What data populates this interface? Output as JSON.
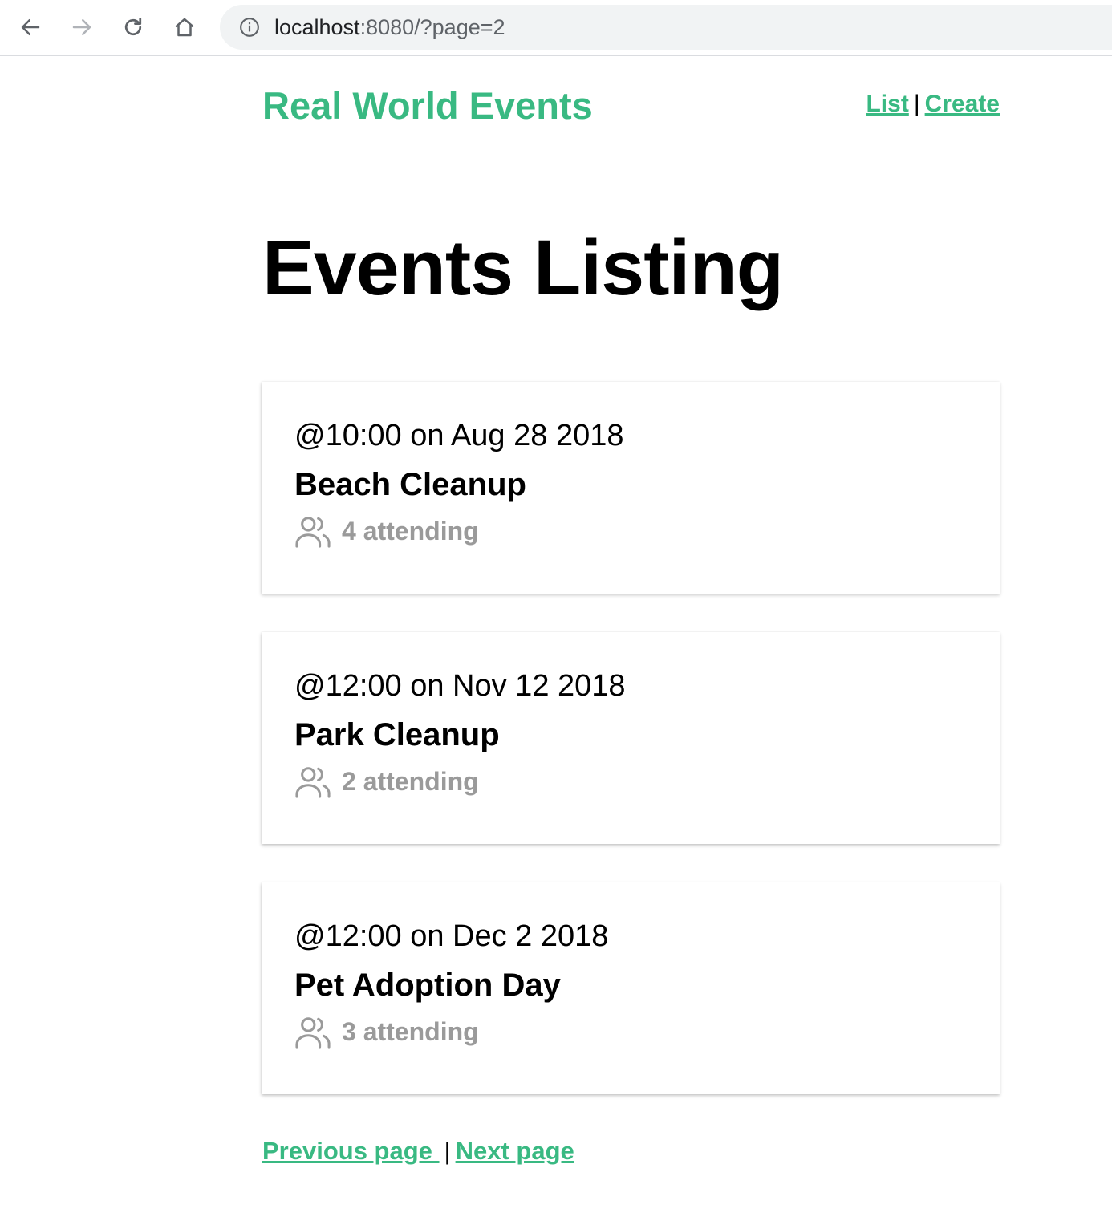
{
  "browser": {
    "url_host": "localhost",
    "url_path": ":8080/?page=2",
    "icons": [
      "back-arrow-icon",
      "forward-arrow-icon",
      "reload-icon",
      "home-icon",
      "info-icon"
    ]
  },
  "header": {
    "brand": "Real World Events",
    "nav": {
      "list": "List",
      "separator": "|",
      "create": "Create"
    }
  },
  "main": {
    "title": "Events Listing",
    "events": [
      {
        "time": "@10:00 on Aug 28 2018",
        "title": "Beach Cleanup",
        "attending": "4 attending"
      },
      {
        "time": "@12:00 on Nov 12 2018",
        "title": "Park Cleanup",
        "attending": "2 attending"
      },
      {
        "time": "@12:00 on Dec 2 2018",
        "title": "Pet Adoption Day",
        "attending": "3 attending"
      }
    ]
  },
  "pager": {
    "previous": "Previous page ",
    "separator": "|",
    "next": "Next page"
  },
  "colors": {
    "accent": "#39b982",
    "muted": "#9a9a9a"
  }
}
